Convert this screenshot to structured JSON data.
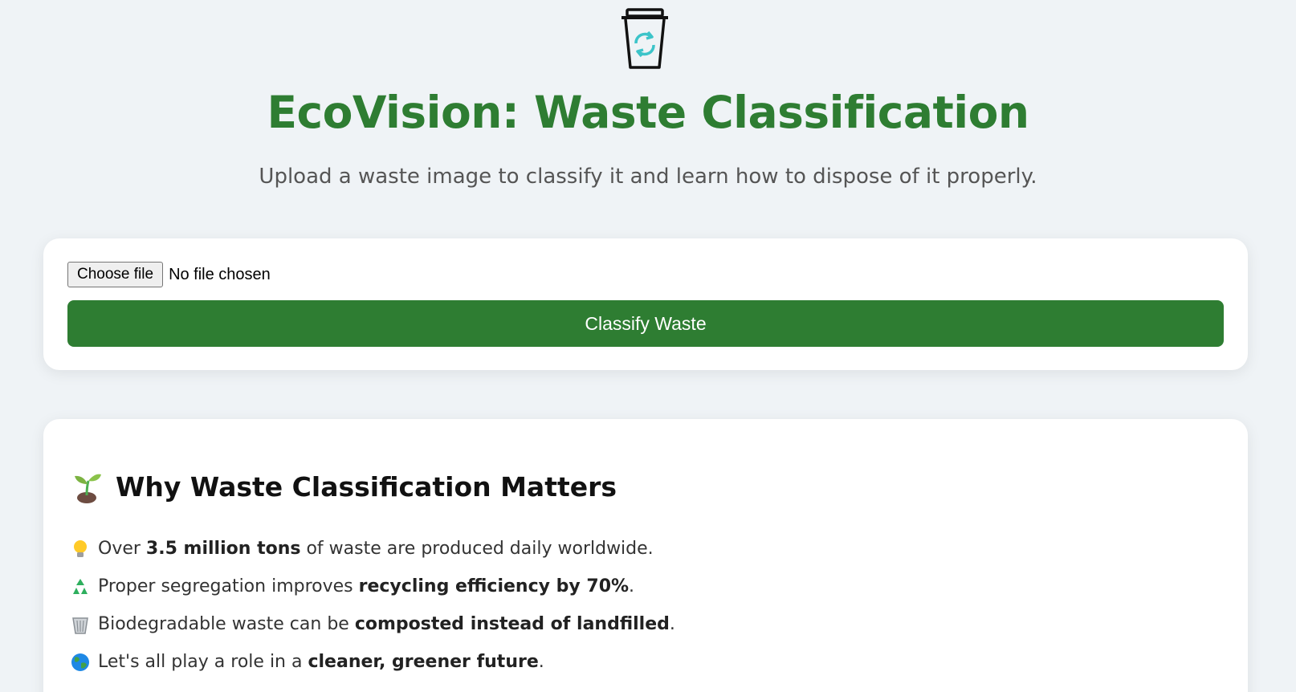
{
  "header": {
    "logo_icon": "recycle-bin-icon",
    "title": "EcoVision: Waste Classification",
    "subtitle": "Upload a waste image to classify it and learn how to dispose of it properly."
  },
  "upload": {
    "choose_file_label": "Choose file",
    "file_status": "No file chosen",
    "classify_label": "Classify Waste"
  },
  "info": {
    "heading_icon": "sprout-icon",
    "heading": "Why Waste Classification Matters",
    "facts": [
      {
        "icon": "lightbulb-icon",
        "pre": "Over ",
        "bold": "3.5 million tons",
        "post": " of waste are produced daily worldwide."
      },
      {
        "icon": "recycle-icon",
        "pre": "Proper segregation improves ",
        "bold": "recycling efficiency by 70%",
        "post": "."
      },
      {
        "icon": "wastebasket-icon",
        "pre": "Biodegradable waste can be ",
        "bold": "composted instead of landfilled",
        "post": "."
      },
      {
        "icon": "globe-icon",
        "pre": "Let's all play a role in a ",
        "bold": "cleaner, greener future",
        "post": "."
      }
    ]
  },
  "colors": {
    "brand_green": "#2e7d32",
    "background": "#eff3f6",
    "logo_accent": "#3cc4c9"
  }
}
